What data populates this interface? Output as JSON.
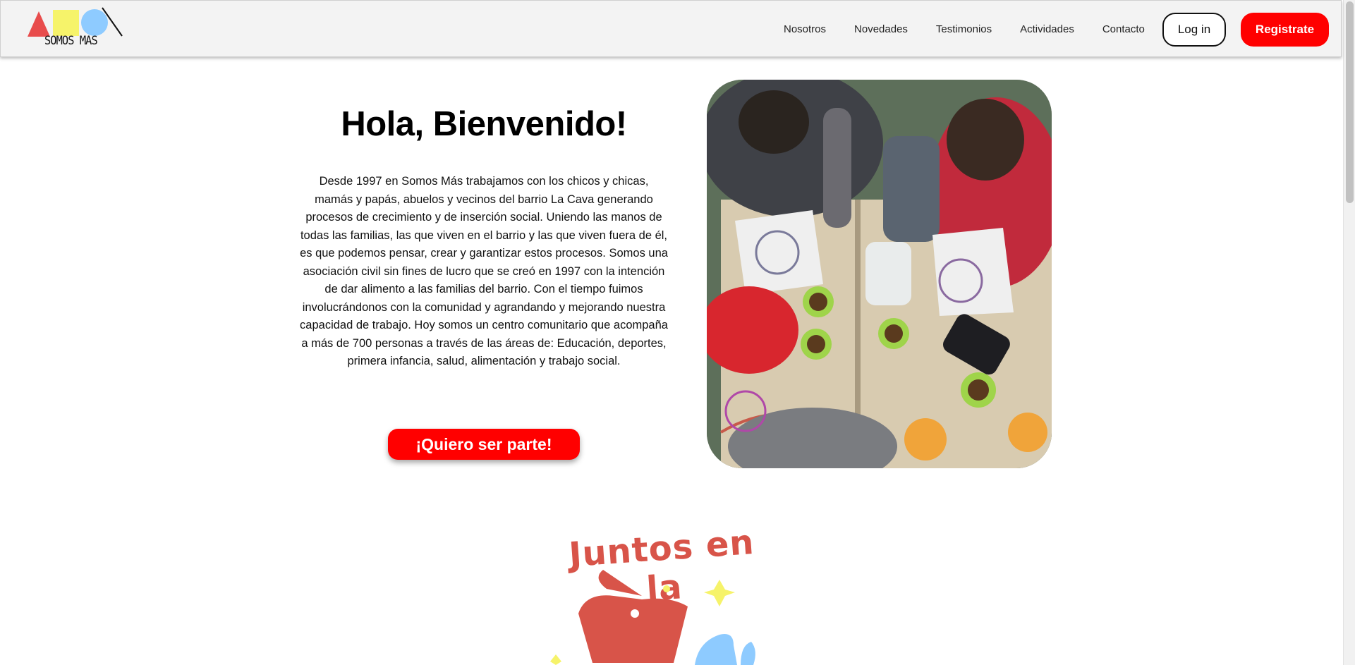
{
  "header": {
    "logo_text": "SOMOS MAS",
    "nav": [
      "Nosotros",
      "Novedades",
      "Testimonios",
      "Actividades",
      "Contacto"
    ],
    "login_label": "Log in",
    "register_label": "Registrate"
  },
  "hero": {
    "title": "Hola, Bienvenido!",
    "description": "Desde 1997 en Somos Más trabajamos con los chicos y chicas, mamás y papás, abuelos y vecinos del barrio La Cava generando procesos de crecimiento y de inserción social. Uniendo las manos de todas las familias, las que viven en el barrio y las que viven fuera de él, es que podemos pensar, crear y garantizar estos procesos. Somos una asociación civil sin fines de lucro que se creó en 1997 con la intención de dar alimento a las familias del barrio. Con el tiempo fuimos involucrándonos con la comunidad y agrandando y mejorando nuestra capacidad de trabajo. Hoy somos un centro comunitario que acompaña a más de 700 personas a través de las áreas de: Educación, deportes, primera infancia, salud, alimentación y trabajo social.",
    "cta_label": "¡Quiero ser parte!"
  },
  "campaign": {
    "logo_text": "Juntos en la"
  },
  "colors": {
    "accent": "#ff0000",
    "logo_red": "#e84c4c",
    "logo_yellow": "#f6f36a",
    "logo_blue": "#8ecbff",
    "campaign_red": "#d85449"
  }
}
